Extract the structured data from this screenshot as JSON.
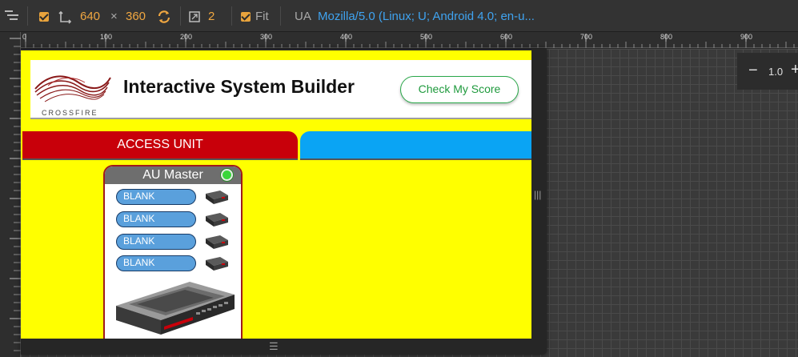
{
  "toolbar": {
    "width": "640",
    "times": "×",
    "height": "360",
    "dpr": "2",
    "fit_label": "Fit",
    "ua_label": "UA",
    "ua_value": "Mozilla/5.0 (Linux; U; Android 4.0; en-u..."
  },
  "ruler": {
    "labels": [
      "0",
      "100",
      "200",
      "300",
      "400",
      "500",
      "600",
      "700",
      "800",
      "900"
    ]
  },
  "zoom": {
    "minus": "−",
    "value": "1.0",
    "plus": "+"
  },
  "app": {
    "logo_text": "CROSSFIRE",
    "title": "Interactive System Builder",
    "score_button": "Check My Score",
    "tab_access_unit": "ACCESS UNIT",
    "au_card": {
      "title": "AU Master",
      "slots": [
        "BLANK",
        "BLANK",
        "BLANK",
        "BLANK"
      ]
    }
  },
  "colors": {
    "app_background": "#ffff00",
    "tab_red": "#c8000a",
    "tab_blue": "#0aa4f4",
    "accent_orange": "#f0a741",
    "ua_blue": "#3fa3f0",
    "slot_blue": "#5aa0dc"
  },
  "icons": [
    "menu-icon",
    "resize-icon",
    "rotate-icon",
    "screen-icon",
    "status-led-icon",
    "sfp-module-icon",
    "chassis-image"
  ]
}
